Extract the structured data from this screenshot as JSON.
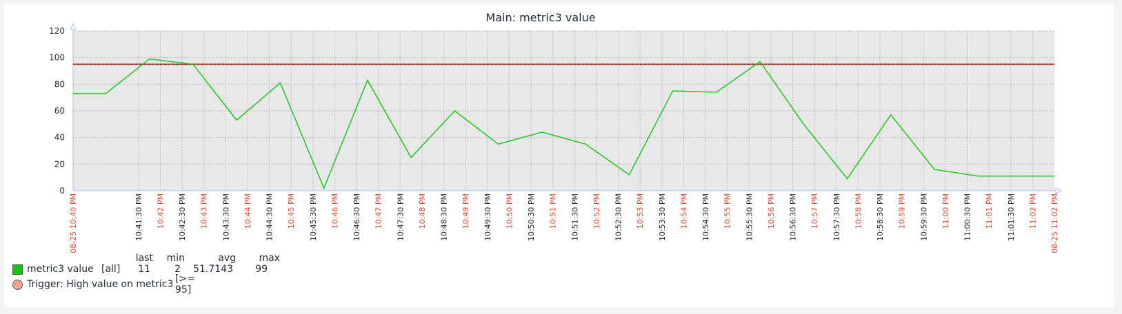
{
  "chart_data": {
    "type": "line",
    "title": "Main: metric3 value",
    "ylim": [
      0,
      120
    ],
    "yticks": [
      0,
      20,
      40,
      60,
      80,
      100,
      120
    ],
    "xlim_minutes": [
      0,
      22.5
    ],
    "x_tick_labels": [
      {
        "t": 0.0,
        "label": "08-25 10:40 PM",
        "red": true
      },
      {
        "t": 1.5,
        "label": "10:41:30 PM",
        "red": false
      },
      {
        "t": 2.0,
        "label": "10:42 PM",
        "red": true
      },
      {
        "t": 2.5,
        "label": "10:42:30 PM",
        "red": false
      },
      {
        "t": 3.0,
        "label": "10:43 PM",
        "red": true
      },
      {
        "t": 3.5,
        "label": "10:43:30 PM",
        "red": false
      },
      {
        "t": 4.0,
        "label": "10:44 PM",
        "red": true
      },
      {
        "t": 4.5,
        "label": "10:44:30 PM",
        "red": false
      },
      {
        "t": 5.0,
        "label": "10:45 PM",
        "red": true
      },
      {
        "t": 5.5,
        "label": "10:45:30 PM",
        "red": false
      },
      {
        "t": 6.0,
        "label": "10:46 PM",
        "red": true
      },
      {
        "t": 6.5,
        "label": "10:46:30 PM",
        "red": false
      },
      {
        "t": 7.0,
        "label": "10:47 PM",
        "red": true
      },
      {
        "t": 7.5,
        "label": "10:47:30 PM",
        "red": false
      },
      {
        "t": 8.0,
        "label": "10:48 PM",
        "red": true
      },
      {
        "t": 8.5,
        "label": "10:48:30 PM",
        "red": false
      },
      {
        "t": 9.0,
        "label": "10:49 PM",
        "red": true
      },
      {
        "t": 9.5,
        "label": "10:49:30 PM",
        "red": false
      },
      {
        "t": 10.0,
        "label": "10:50 PM",
        "red": true
      },
      {
        "t": 10.5,
        "label": "10:50:30 PM",
        "red": false
      },
      {
        "t": 11.0,
        "label": "10:51 PM",
        "red": true
      },
      {
        "t": 11.5,
        "label": "10:51:30 PM",
        "red": false
      },
      {
        "t": 12.0,
        "label": "10:52 PM",
        "red": true
      },
      {
        "t": 12.5,
        "label": "10:52:30 PM",
        "red": false
      },
      {
        "t": 13.0,
        "label": "10:53 PM",
        "red": true
      },
      {
        "t": 13.5,
        "label": "10:53:30 PM",
        "red": false
      },
      {
        "t": 14.0,
        "label": "10:54 PM",
        "red": true
      },
      {
        "t": 14.5,
        "label": "10:54:30 PM",
        "red": false
      },
      {
        "t": 15.0,
        "label": "10:55 PM",
        "red": true
      },
      {
        "t": 15.5,
        "label": "10:55:30 PM",
        "red": false
      },
      {
        "t": 16.0,
        "label": "10:56 PM",
        "red": true
      },
      {
        "t": 16.5,
        "label": "10:56:30 PM",
        "red": false
      },
      {
        "t": 17.0,
        "label": "10:57 PM",
        "red": true
      },
      {
        "t": 17.5,
        "label": "10:57:30 PM",
        "red": false
      },
      {
        "t": 18.0,
        "label": "10:58 PM",
        "red": true
      },
      {
        "t": 18.5,
        "label": "10:58:30 PM",
        "red": false
      },
      {
        "t": 19.0,
        "label": "10:59 PM",
        "red": true
      },
      {
        "t": 19.5,
        "label": "10:59:30 PM",
        "red": false
      },
      {
        "t": 20.0,
        "label": "11:00 PM",
        "red": true
      },
      {
        "t": 20.5,
        "label": "11:00:30 PM",
        "red": false
      },
      {
        "t": 21.0,
        "label": "11:01 PM",
        "red": true
      },
      {
        "t": 21.5,
        "label": "11:01:30 PM",
        "red": false
      },
      {
        "t": 22.0,
        "label": "11:02 PM",
        "red": true
      },
      {
        "t": 22.5,
        "label": "08-25 11:02 PM",
        "red": true
      }
    ],
    "series": [
      {
        "name": "metric3 value",
        "color": "#19c819",
        "points": [
          [
            0.0,
            73
          ],
          [
            0.75,
            73
          ],
          [
            1.75,
            99
          ],
          [
            2.75,
            95
          ],
          [
            3.75,
            53
          ],
          [
            4.75,
            81
          ],
          [
            5.75,
            2
          ],
          [
            6.75,
            83
          ],
          [
            7.75,
            25
          ],
          [
            8.75,
            60
          ],
          [
            9.75,
            35
          ],
          [
            10.75,
            44
          ],
          [
            11.75,
            35
          ],
          [
            12.75,
            12
          ],
          [
            13.75,
            75
          ],
          [
            14.75,
            74
          ],
          [
            15.75,
            97
          ],
          [
            16.75,
            50
          ],
          [
            17.75,
            9
          ],
          [
            18.75,
            57
          ],
          [
            19.75,
            16
          ],
          [
            20.75,
            11
          ],
          [
            22.5,
            11
          ]
        ]
      }
    ],
    "trigger_threshold": 95,
    "grid": true
  },
  "legend": {
    "headers": {
      "last": "last",
      "min": "min",
      "avg": "avg",
      "max": "max"
    },
    "metric": {
      "name": "metric3 value",
      "scope": "[all]",
      "last": "11",
      "min": "2",
      "avg": "51.7143",
      "max": "99"
    },
    "trigger": {
      "name": "Trigger: High value on metric3",
      "condition": "[>= 95]"
    }
  },
  "colors": {
    "plot_bg": "#e8e8e8",
    "grid": "#b5b5b5",
    "series": "#19c819",
    "trigger_line": "#e8452c",
    "red_label": "#e8452c",
    "axis": "#a9c4e2"
  }
}
